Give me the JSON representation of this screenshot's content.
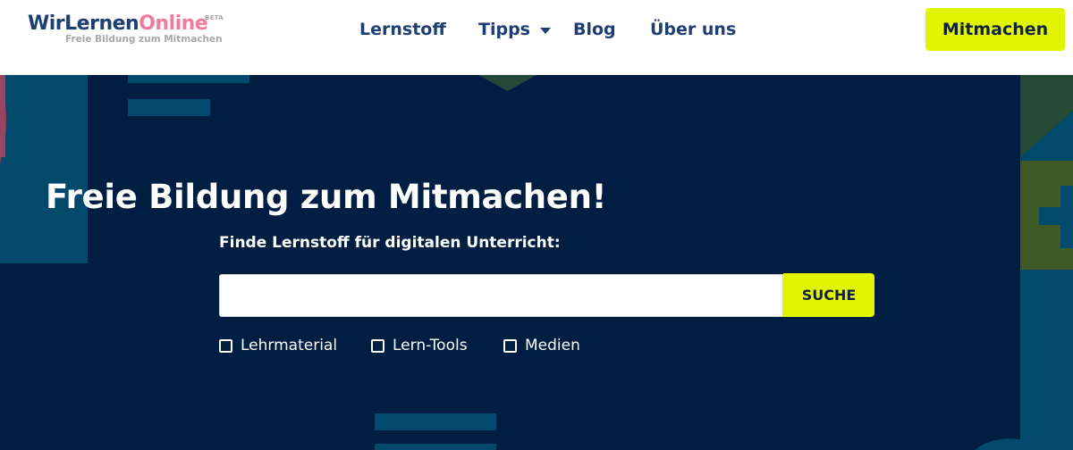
{
  "brand": {
    "name_part1": "WirLernen",
    "name_part2": "Online",
    "badge": "BETA",
    "tagline": "Freie Bildung zum Mitmachen"
  },
  "nav": {
    "items": [
      {
        "label": "Lernstoff"
      },
      {
        "label": "Tipps"
      },
      {
        "label": "Blog"
      },
      {
        "label": "Über uns"
      }
    ],
    "cta_label": "Mitmachen"
  },
  "hero": {
    "title": "Freie Bildung zum Mitmachen!",
    "subtitle": "Finde Lernstoff für digitalen Unterricht:",
    "search": {
      "value": "",
      "placeholder": "",
      "button_label": "SUCHE"
    },
    "filters": [
      {
        "label": "Lehrmaterial",
        "checked": false
      },
      {
        "label": "Lern-Tools",
        "checked": false
      },
      {
        "label": "Medien",
        "checked": false
      }
    ]
  },
  "colors": {
    "brand_blue": "#1e3f73",
    "brand_pink": "#f07b9b",
    "accent_yellow": "#e2f500",
    "hero_bg": "#001e42"
  },
  "icons": [
    "chevron-down-icon",
    "checkbox-icon"
  ]
}
